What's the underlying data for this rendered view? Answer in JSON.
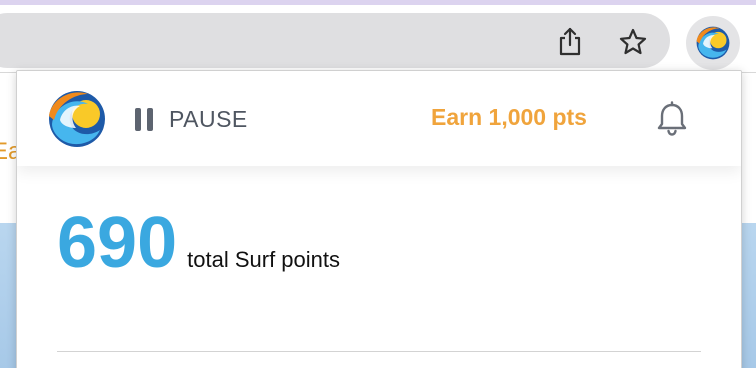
{
  "browser": {
    "toolbar": {
      "share_icon": "share-icon",
      "bookmark_icon": "star-icon",
      "extension_icon": "surf-wave-logo-icon"
    },
    "background_page": {
      "partial_text": "Ea"
    }
  },
  "popup": {
    "logo_icon": "surf-wave-logo-icon",
    "pause": {
      "icon": "pause-icon",
      "label": "PAUSE"
    },
    "earn_link": "Earn 1,000 pts",
    "notifications_icon": "bell-icon",
    "points": {
      "value": "690",
      "label": "total Surf points"
    }
  },
  "colors": {
    "accent_orange": "#f0a43c",
    "points_blue": "#3aa8e0",
    "top_accent": "#dcd3ef",
    "omnibox_gray": "#dfdfe1"
  }
}
